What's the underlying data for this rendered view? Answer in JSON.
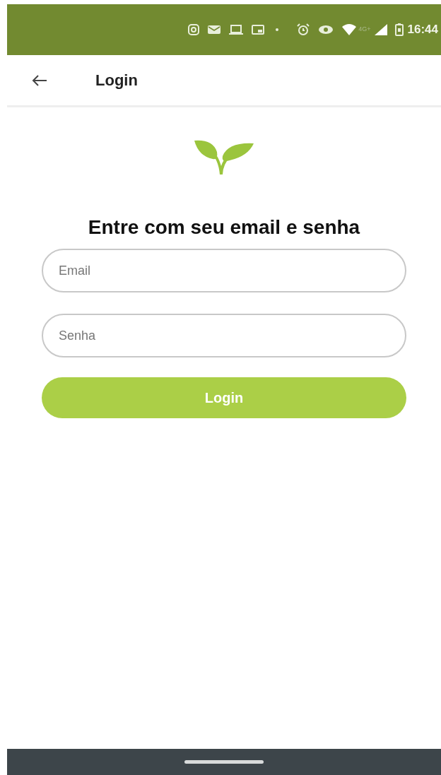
{
  "status_bar": {
    "network": "4G+",
    "time": "16:44"
  },
  "app_bar": {
    "title": "Login"
  },
  "heading": "Entre com seu email e senha",
  "fields": [
    {
      "placeholder": "Email"
    },
    {
      "placeholder": "Senha"
    }
  ],
  "button": "Login"
}
